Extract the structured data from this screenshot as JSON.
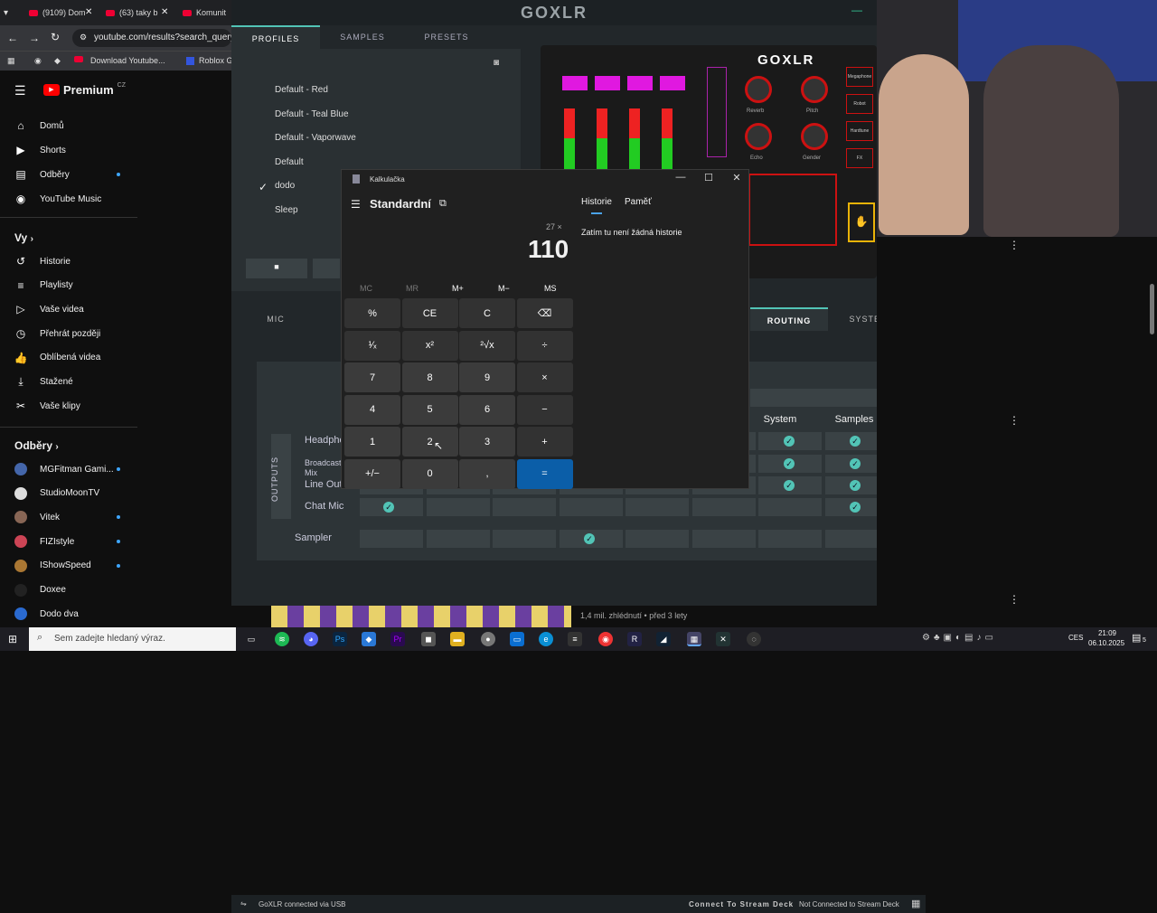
{
  "browser": {
    "tabs": [
      "(9109) Dom",
      "(63) taky b",
      "Komunit"
    ],
    "url": "youtube.com/results?search_query=d",
    "bookmarks": [
      "Download Youtube...",
      "Roblox Gr"
    ]
  },
  "youtube": {
    "logo": "Premium",
    "region": "CZ",
    "main_nav": [
      {
        "label": "Domů",
        "icon": "home-icon"
      },
      {
        "label": "Shorts",
        "icon": "shorts-icon"
      },
      {
        "label": "Odběry",
        "icon": "subscriptions-icon"
      },
      {
        "label": "YouTube Music",
        "icon": "music-icon"
      }
    ],
    "you_heading": "Vy",
    "you_nav": [
      {
        "label": "Historie",
        "icon": "history-icon"
      },
      {
        "label": "Playlisty",
        "icon": "playlist-icon"
      },
      {
        "label": "Vaše videa",
        "icon": "video-icon"
      },
      {
        "label": "Přehrát později",
        "icon": "clock-icon"
      },
      {
        "label": "Oblíbená videa",
        "icon": "like-icon"
      },
      {
        "label": "Stažené",
        "icon": "download-icon"
      },
      {
        "label": "Vaše klipy",
        "icon": "scissors-icon"
      }
    ],
    "subs_heading": "Odběry",
    "subs": [
      {
        "label": "MGFitman Gami...",
        "color": "#4466aa"
      },
      {
        "label": "StudioMoonTV",
        "color": "#dddddd"
      },
      {
        "label": "Vitek",
        "color": "#886655"
      },
      {
        "label": "FIZIstyle",
        "color": "#cc4455"
      },
      {
        "label": "IShowSpeed",
        "color": "#aa7733"
      },
      {
        "label": "Doxee",
        "color": "#222222"
      },
      {
        "label": "Dodo dva",
        "color": "#2a6ad0"
      }
    ],
    "video_meta": "1,4 mil. zhlédnutí • před 3 lety"
  },
  "goxlr": {
    "title": "GOXLR",
    "tabs": [
      "PROFILES",
      "SAMPLES",
      "PRESETS"
    ],
    "profiles": [
      "Default - Red",
      "Default - Teal Blue",
      "Default - Vaporwave",
      "Default",
      "dodo",
      "Sleep"
    ],
    "selected_profile": "dodo",
    "device_logo": "GOXLR",
    "knob_labels": [
      "Reverb",
      "Pitch",
      "Echo",
      "Gender"
    ],
    "side_buttons": [
      "Megaphone",
      "Robot",
      "Hardtune",
      "FX"
    ],
    "lower_tabs": [
      "MIC",
      "ROUTING",
      "SYSTEM"
    ],
    "routing_cols": [
      "System",
      "Samples"
    ],
    "outputs_label": "OUTPUTS",
    "rows": [
      "Headphones",
      "Broadcast Stream Mix",
      "Line Out",
      "Chat Mic",
      "Sampler"
    ],
    "status_left": "GoXLR connected via USB",
    "status_mid": "Connect To Stream Deck",
    "status_right": "Not Connected to Stream Deck"
  },
  "calculator": {
    "title": "Kalkulačka",
    "mode": "Standardní",
    "expression": "27 ×",
    "display": "110",
    "history_tab": "Historie",
    "memory_tab": "Paměť",
    "history_empty": "Zatím tu není žádná historie",
    "memory": [
      "MC",
      "MR",
      "M+",
      "M−",
      "MS"
    ],
    "keys": [
      "%",
      "CE",
      "C",
      "⌫",
      "¹⁄ₓ",
      "x²",
      "²√x",
      "÷",
      "7",
      "8",
      "9",
      "×",
      "4",
      "5",
      "6",
      "−",
      "1",
      "2",
      "3",
      "+",
      "+/−",
      "0",
      ",",
      "="
    ]
  },
  "taskbar": {
    "search_placeholder": "Sem zadejte hledaný výraz.",
    "lang": "CES",
    "time": "21:09",
    "date": "06.10.2025",
    "notif": "5"
  }
}
